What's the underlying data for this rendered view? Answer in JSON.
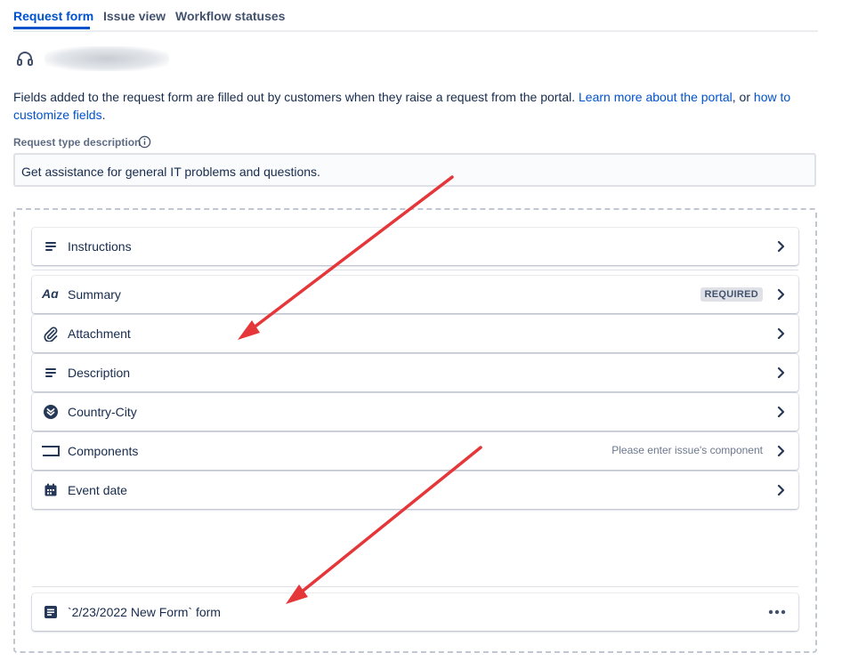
{
  "tabs": [
    {
      "label": "Request form",
      "active": true
    },
    {
      "label": "Issue view",
      "active": false
    },
    {
      "label": "Workflow statuses",
      "active": false
    }
  ],
  "header": {
    "icon": "headset-icon"
  },
  "intro": {
    "text": "Fields added to the request form are filled out by customers when they raise a request from the portal. ",
    "link1": "Learn more about the portal",
    "middle": ", or ",
    "link2_a": "how to",
    "link2_b": "customize fields",
    "end": "."
  },
  "request_type": {
    "label": "Request type description",
    "value": "Get assistance for general IT problems and questions."
  },
  "fields": [
    {
      "label": "Instructions",
      "icon": "text-lines-icon"
    },
    {
      "label": "Summary",
      "icon": "text-style-icon",
      "badge": "REQUIRED"
    },
    {
      "label": "Attachment",
      "icon": "paperclip-icon"
    },
    {
      "label": "Description",
      "icon": "text-lines-icon"
    },
    {
      "label": "Country-City",
      "icon": "cascading-select-icon"
    },
    {
      "label": "Components",
      "icon": "component-icon",
      "hint": "Please enter issue's component"
    },
    {
      "label": "Event date",
      "icon": "calendar-icon"
    }
  ],
  "form": {
    "label": "`2/23/2022 New Form` form",
    "icon": "form-icon"
  },
  "colors": {
    "accent": "#0052cc",
    "annotation_arrow": "#e5373a",
    "text": "#172b4d"
  }
}
